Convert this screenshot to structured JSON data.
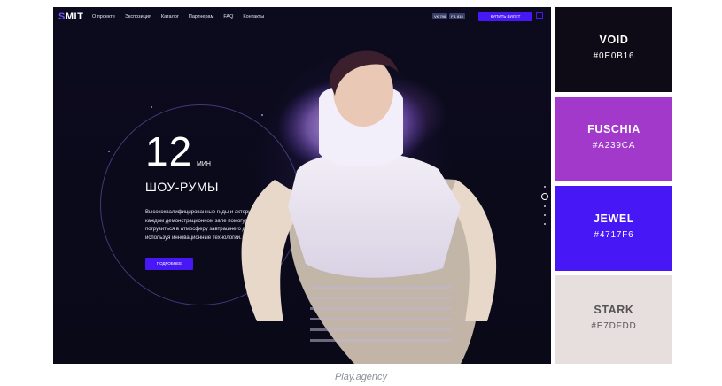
{
  "site": {
    "logo_mark": "S",
    "logo_rest": "MIT",
    "nav": [
      "О проекте",
      "Экспозиция",
      "Каталог",
      "Партнерам",
      "FAQ",
      "Контакты"
    ],
    "social": [
      "VK 798",
      "F 1 815"
    ],
    "buy_label": "КУПИТЬ БИЛЕТ",
    "ticket_icon": "ticket-icon"
  },
  "hero": {
    "number": "12",
    "unit": "МИН",
    "title": "ШОУ-РУМЫ",
    "text": "Высококвалифицированные гиды и актеры в каждом демонстрационном зале помогут погрузиться в атмосферу завтрашнего дня, используя инновационные технологии.",
    "more_label": "ПОДРОБНЕЕ"
  },
  "palette": [
    {
      "name": "VOID",
      "hex": "#0E0B16",
      "color": "#0e0b16",
      "text_color": "#ffffff"
    },
    {
      "name": "FUSCHIA",
      "hex": "#A239CA",
      "color": "#a239ca",
      "text_color": "#ffffff"
    },
    {
      "name": "JEWEL",
      "hex": "#4717F6",
      "color": "#4717f6",
      "text_color": "#ffffff"
    },
    {
      "name": "STARK",
      "hex": "#E7DFDD",
      "color": "#e7dfdd",
      "text_color": "#555555"
    }
  ],
  "caption": "Play.agency"
}
